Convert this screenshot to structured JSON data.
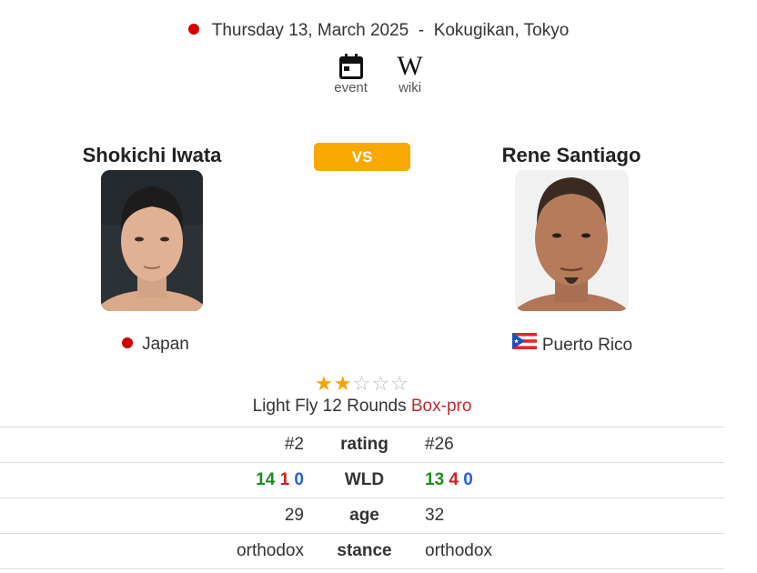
{
  "event": {
    "date": "Thursday 13, March 2025",
    "separator": "-",
    "venue": "Kokugikan, Tokyo",
    "links": [
      {
        "label": "event",
        "icon": "calendar-icon"
      },
      {
        "label": "wiki",
        "icon": "wikipedia-icon"
      }
    ]
  },
  "vs_label": "VS",
  "fighters": {
    "left": {
      "name": "Shokichi Iwata",
      "country": "Japan"
    },
    "right": {
      "name": "Rene Santiago",
      "country": "Puerto Rico"
    }
  },
  "bout": {
    "stars": 2,
    "stars_max": 5,
    "weight_rounds": "Light Fly 12 Rounds",
    "type": "Box-pro"
  },
  "stats": {
    "rating": {
      "label": "rating",
      "left": "#2",
      "right": "#26"
    },
    "wld": {
      "label": "WLD",
      "left": {
        "w": "14",
        "l": "1",
        "d": "0"
      },
      "right": {
        "w": "13",
        "l": "4",
        "d": "0"
      }
    },
    "age": {
      "label": "age",
      "left": "29",
      "right": "32"
    },
    "stance": {
      "label": "stance",
      "left": "orthodox",
      "right": "orthodox"
    }
  },
  "colors": {
    "accent": "#f9a800",
    "win": "#1f8a1f",
    "loss": "#cc1f1f",
    "draw": "#2b5fd9",
    "box_pro": "#c0282d"
  }
}
